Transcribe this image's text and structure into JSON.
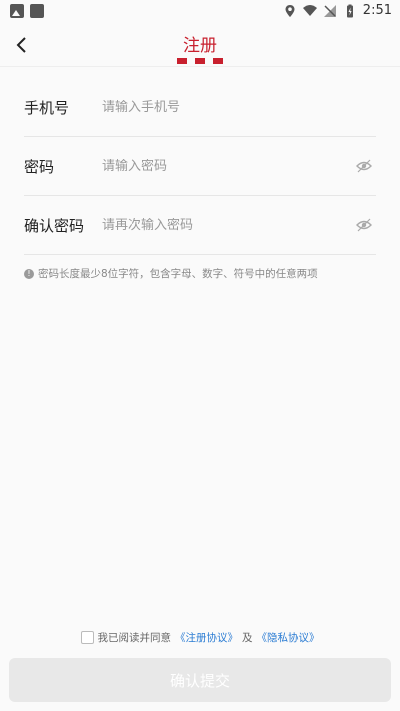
{
  "status_bar": {
    "time": "2:51"
  },
  "header": {
    "title": "注册"
  },
  "form": {
    "phone": {
      "label": "手机号",
      "placeholder": "请输入手机号"
    },
    "password": {
      "label": "密码",
      "placeholder": "请输入密码"
    },
    "confirm": {
      "label": "确认密码",
      "placeholder": "请再次输入密码"
    },
    "hint": "密码长度最少8位字符，包含字母、数字、符号中的任意两项"
  },
  "agreement": {
    "prefix": "我已阅读并同意",
    "link1": "《注册协议》",
    "and": "及",
    "link2": "《隐私协议》"
  },
  "submit": {
    "label": "确认提交"
  }
}
